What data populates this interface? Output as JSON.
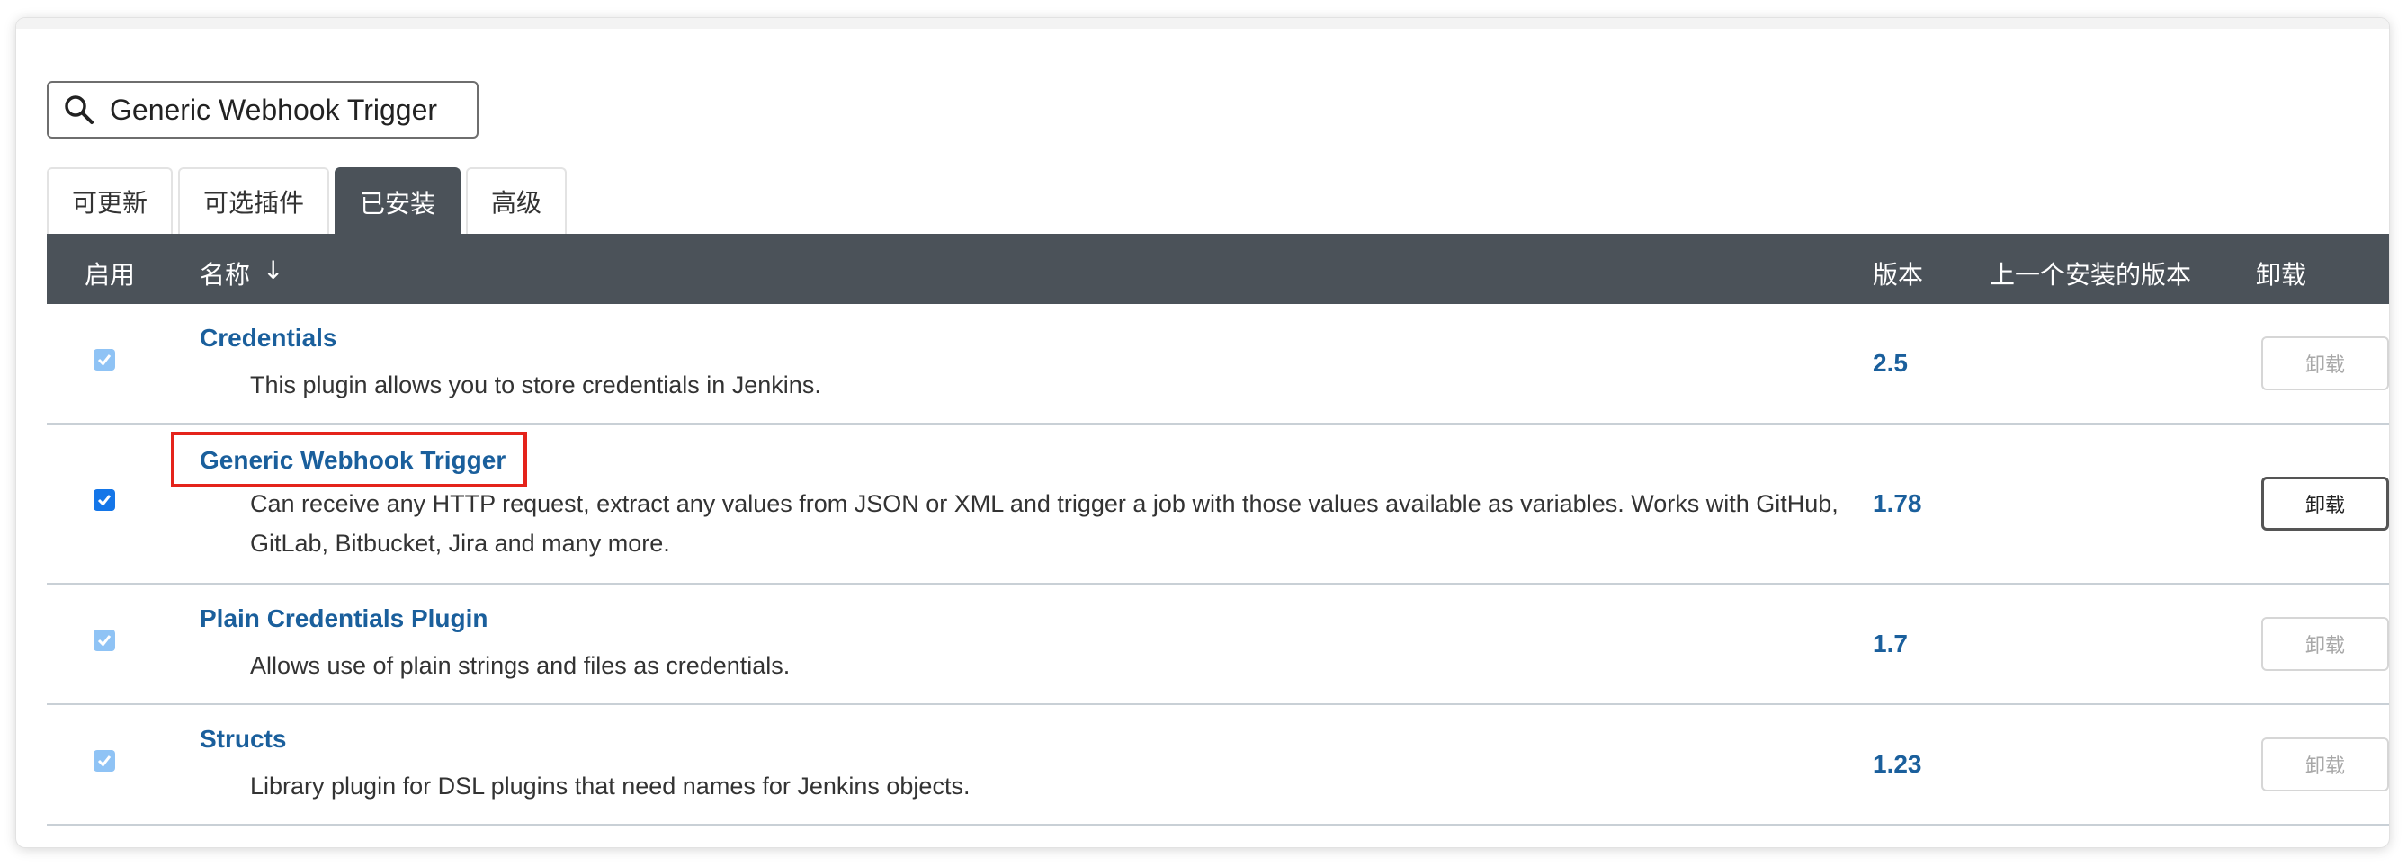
{
  "search": {
    "value": "Generic Webhook Trigger",
    "icon": "search-icon"
  },
  "tabs": [
    {
      "label": "可更新",
      "active": false
    },
    {
      "label": "可选插件",
      "active": false
    },
    {
      "label": "已安装",
      "active": true
    },
    {
      "label": "高级",
      "active": false
    }
  ],
  "table": {
    "headers": {
      "enabled": "启用",
      "name": "名称",
      "sort_arrow": "↓",
      "version": "版本",
      "previous_version": "上一个安装的版本",
      "uninstall": "卸载"
    },
    "rows": [
      {
        "name": "Credentials",
        "description": "This plugin allows you to store credentials in Jenkins.",
        "version": "2.5",
        "uninstall_label": "卸载",
        "checked": true,
        "checkbox_disabled": true,
        "uninstall_enabled": false
      },
      {
        "name": "Generic Webhook Trigger",
        "description": "Can receive any HTTP request, extract any values from JSON or XML and trigger a job with those values available as variables. Works with GitHub, GitLab, Bitbucket, Jira and many more.",
        "version": "1.78",
        "uninstall_label": "卸载",
        "checked": true,
        "checkbox_disabled": false,
        "uninstall_enabled": true,
        "highlighted": true
      },
      {
        "name": "Plain Credentials Plugin",
        "description": "Allows use of plain strings and files as credentials.",
        "version": "1.7",
        "uninstall_label": "卸载",
        "checked": true,
        "checkbox_disabled": true,
        "uninstall_enabled": false
      },
      {
        "name": "Structs",
        "description": "Library plugin for DSL plugins that need names for Jenkins objects.",
        "version": "1.23",
        "uninstall_label": "卸载",
        "checked": true,
        "checkbox_disabled": true,
        "uninstall_enabled": false
      }
    ]
  },
  "colors": {
    "header_bg": "#4b5259",
    "link": "#1a5f9c",
    "highlight_box": "#e4231b",
    "checkbox_enabled": "#1476e8",
    "checkbox_disabled": "#8fc3f5"
  }
}
